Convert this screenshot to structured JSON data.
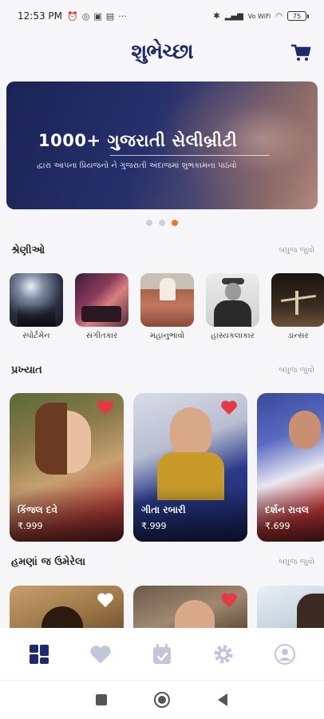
{
  "status": {
    "time": "12:53 PM",
    "notif_icons": [
      "alarm-icon",
      "whatsapp-icon",
      "message-icon",
      "sim-icon"
    ],
    "more": "···",
    "network": "Vo WiFi",
    "battery": "75"
  },
  "header": {
    "logo": "શુભેચ્છા",
    "cart_icon": "cart-icon"
  },
  "banner": {
    "title": "1000+ ગુજરાતી સેલીબ્રીટી",
    "subtitle": "દ્વારા આપના પ્રિયજનો ને ગુજરાતી અંદાજમાં શુભકામના પાઠવો"
  },
  "carousel": {
    "total": 3,
    "active_index": 2
  },
  "categories_section": {
    "title": "શ્રેણીઓ",
    "more": "બધુજ જુવો",
    "items": [
      {
        "label": "સ્પોર્ટમેન"
      },
      {
        "label": "સંગીતકાર"
      },
      {
        "label": "મહાનુભાવો"
      },
      {
        "label": "હાસ્યકલાકાર"
      },
      {
        "label": "ડાન્સર"
      }
    ]
  },
  "popular_section": {
    "title": "પ્રખ્યાત",
    "more": "બધુજ જુવો",
    "cards": [
      {
        "name": "કિંજલ દવે",
        "price": "₹.999"
      },
      {
        "name": "ગીતા રબારી",
        "price": "₹.999"
      },
      {
        "name": "દર્શન રાવલ",
        "price": "₹.699"
      }
    ]
  },
  "recent_section": {
    "title": "હમણાં જ ઉમેરેલા",
    "more": "બધુજ જુવો"
  },
  "bottom_nav": {
    "items": [
      "home-icon",
      "favorites-icon",
      "calendar-icon",
      "settings-icon",
      "profile-icon"
    ],
    "active": "home-icon"
  },
  "colors": {
    "brand": "#1f2a6b",
    "accent": "#f07a1a",
    "heart": "#e63946",
    "inactive": "#c3c6d8"
  }
}
